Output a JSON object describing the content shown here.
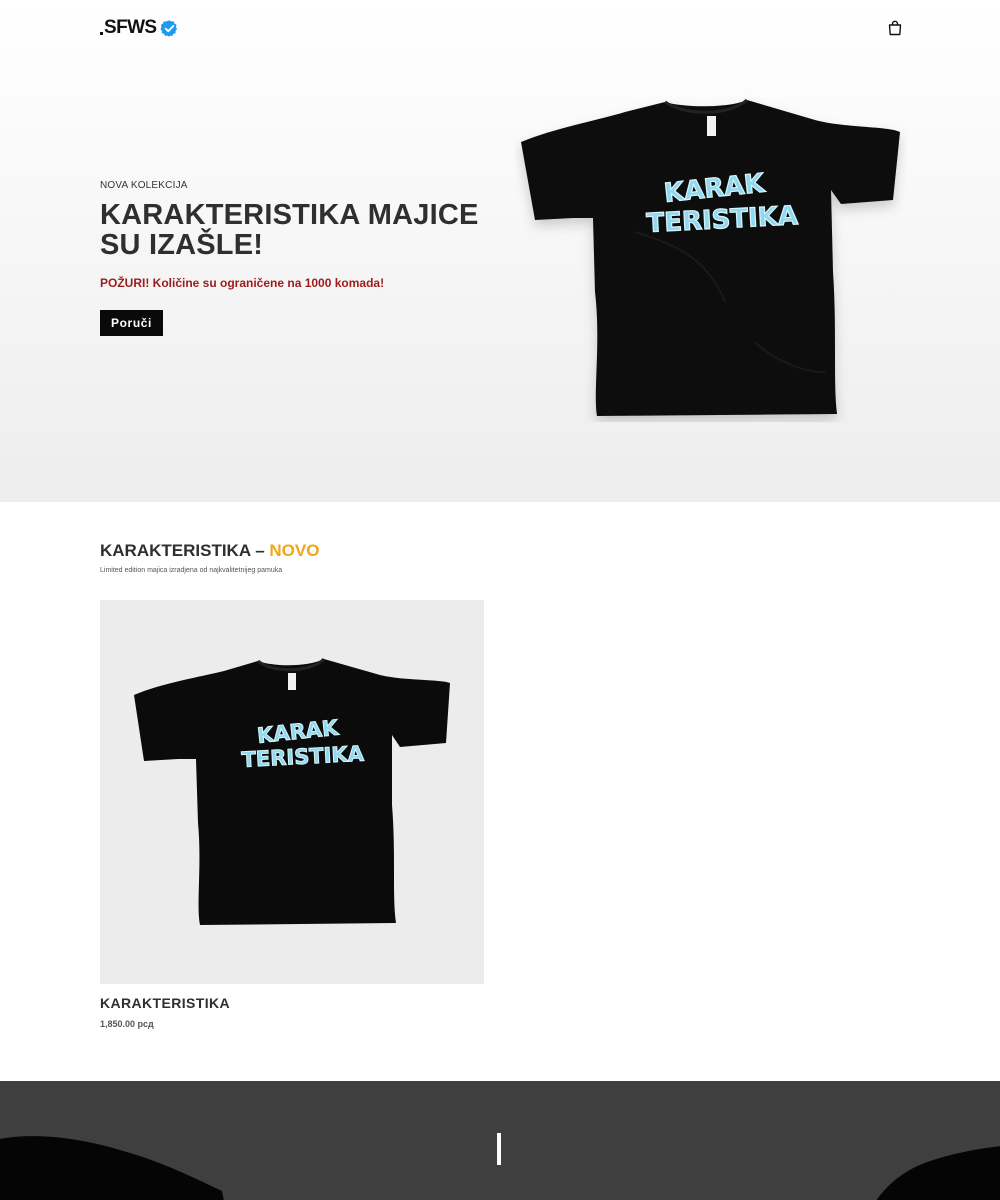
{
  "header": {
    "logo_text": "SFWS",
    "verified_icon": "verified-badge-icon",
    "cart_icon": "shopping-bag-icon",
    "colors": {
      "verified": "#1d9bf0"
    }
  },
  "hero": {
    "eyebrow": "NOVA KOLEKCIJA",
    "title": "KARAKTERISTIKA MAJICE SU IZAŠLE!",
    "note": "POŽURI! Količine su ograničene na 1000 komada!",
    "button_label": "Poruči",
    "shirt_print": [
      "KARAK",
      "TERISTIKA"
    ],
    "colors": {
      "note": "#9b1c1c",
      "button": "#0a0a0a",
      "print": "#8fd8ee"
    }
  },
  "collection": {
    "title_main": "KARAKTERISTIKA – ",
    "title_accent": "NOVO",
    "subtitle": "Limited edition majica izradjena od najkvalitetnijeg pamuka",
    "colors": {
      "accent": "#f2a516"
    },
    "products": [
      {
        "name": "KARAKTERISTIKA",
        "price": "1,850.00 рсд"
      }
    ]
  },
  "band": {
    "colors": {
      "background": "#3f3f3f"
    }
  }
}
